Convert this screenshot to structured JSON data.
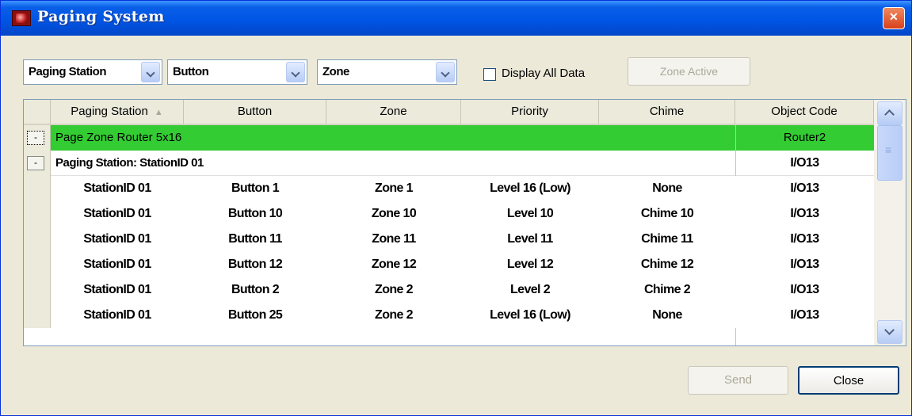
{
  "window": {
    "title": "Paging System"
  },
  "toolbar": {
    "station_combo": "Paging Station",
    "button_combo": "Button",
    "zone_combo": "Zone",
    "display_all_label": "Display All Data",
    "zone_active_label": "Zone Active"
  },
  "grid": {
    "columns": [
      "Paging Station",
      "Button",
      "Zone",
      "Priority",
      "Chime",
      "Object Code"
    ],
    "router_row": {
      "label": "Page Zone Router 5x16",
      "object_code": "Router2"
    },
    "station_group": {
      "label": "Paging Station: StationID 01",
      "object_code": "I/O13"
    },
    "rows": [
      [
        "StationID 01",
        "Button 1",
        "Zone 1",
        "Level 16 (Low)",
        "None",
        "I/O13"
      ],
      [
        "StationID 01",
        "Button 10",
        "Zone 10",
        "Level 10",
        "Chime 10",
        "I/O13"
      ],
      [
        "StationID 01",
        "Button 11",
        "Zone 11",
        "Level 11",
        "Chime 11",
        "I/O13"
      ],
      [
        "StationID 01",
        "Button 12",
        "Zone 12",
        "Level 12",
        "Chime 12",
        "I/O13"
      ],
      [
        "StationID 01",
        "Button 2",
        "Zone 2",
        "Level 2",
        "Chime 2",
        "I/O13"
      ],
      [
        "StationID 01",
        "Button 25",
        "Zone 2",
        "Level 16 (Low)",
        "None",
        "I/O13"
      ]
    ]
  },
  "footer": {
    "send_label": "Send",
    "close_label": "Close"
  },
  "colors": {
    "titlebar": "#0055e5",
    "router_row": "#33cc33",
    "window_bg": "#ece9d8"
  }
}
